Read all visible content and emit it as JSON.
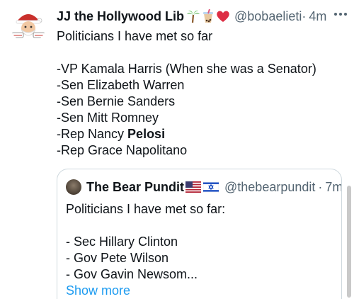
{
  "tweet": {
    "display_name": "JJ the Hollywood Lib",
    "emojis": [
      "palm-tree",
      "bubble-tea",
      "red-heart"
    ],
    "handle": "@bobaelieti·",
    "separator": "·",
    "time": "4m",
    "body_lines": [
      "Politicians I have met so far",
      "",
      "-VP Kamala Harris (When she was a Senator)",
      "-Sen Elizabeth Warren",
      "-Sen Bernie Sanders",
      "-Sen Mitt Romney",
      "-Rep Nancy ",
      "-Rep Grace Napolitano"
    ],
    "bold_word": "Pelosi"
  },
  "quoted_tweet": {
    "display_name": "The Bear Pundit",
    "flags": [
      "us-flag",
      "israel-flag"
    ],
    "handle": "@thebearpundit",
    "separator": "·",
    "time": "7m",
    "body_lines": [
      "Politicians I have met so far:",
      "",
      "- Sec Hillary Clinton",
      "- Gov Pete Wilson",
      "- Gov Gavin Newsom..."
    ],
    "show_more": "Show more"
  },
  "colors": {
    "text": "#0f1419",
    "secondary": "#536471",
    "link": "#1d9bf0",
    "border": "#cfd9de"
  }
}
